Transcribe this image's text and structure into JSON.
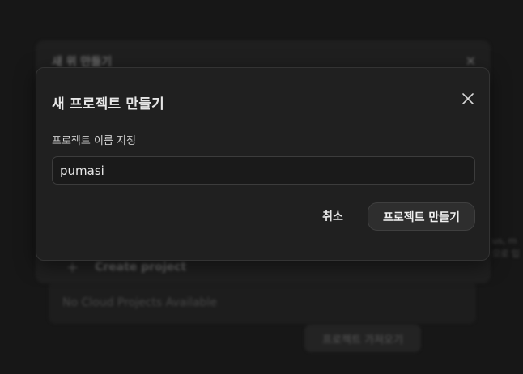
{
  "background": {
    "dialog_title": "새 위 만들기",
    "create_project_label": "Create project",
    "empty_state_label": "No Cloud Projects Available",
    "import_button_label": "프로젝트 가져오기",
    "side_text_line1": "us, m",
    "side_text_line2": "으로 입"
  },
  "modal": {
    "title": "새 프로젝트 만들기",
    "name_label": "프로젝트 이름 지정",
    "name_value": "pumasi",
    "cancel_label": "취소",
    "create_label": "프로젝트 만들기"
  },
  "colors": {
    "page_background": "#171717",
    "modal_background": "#202020",
    "primary_button_background": "#2e2e2e",
    "text_primary": "#e6e6e6"
  }
}
